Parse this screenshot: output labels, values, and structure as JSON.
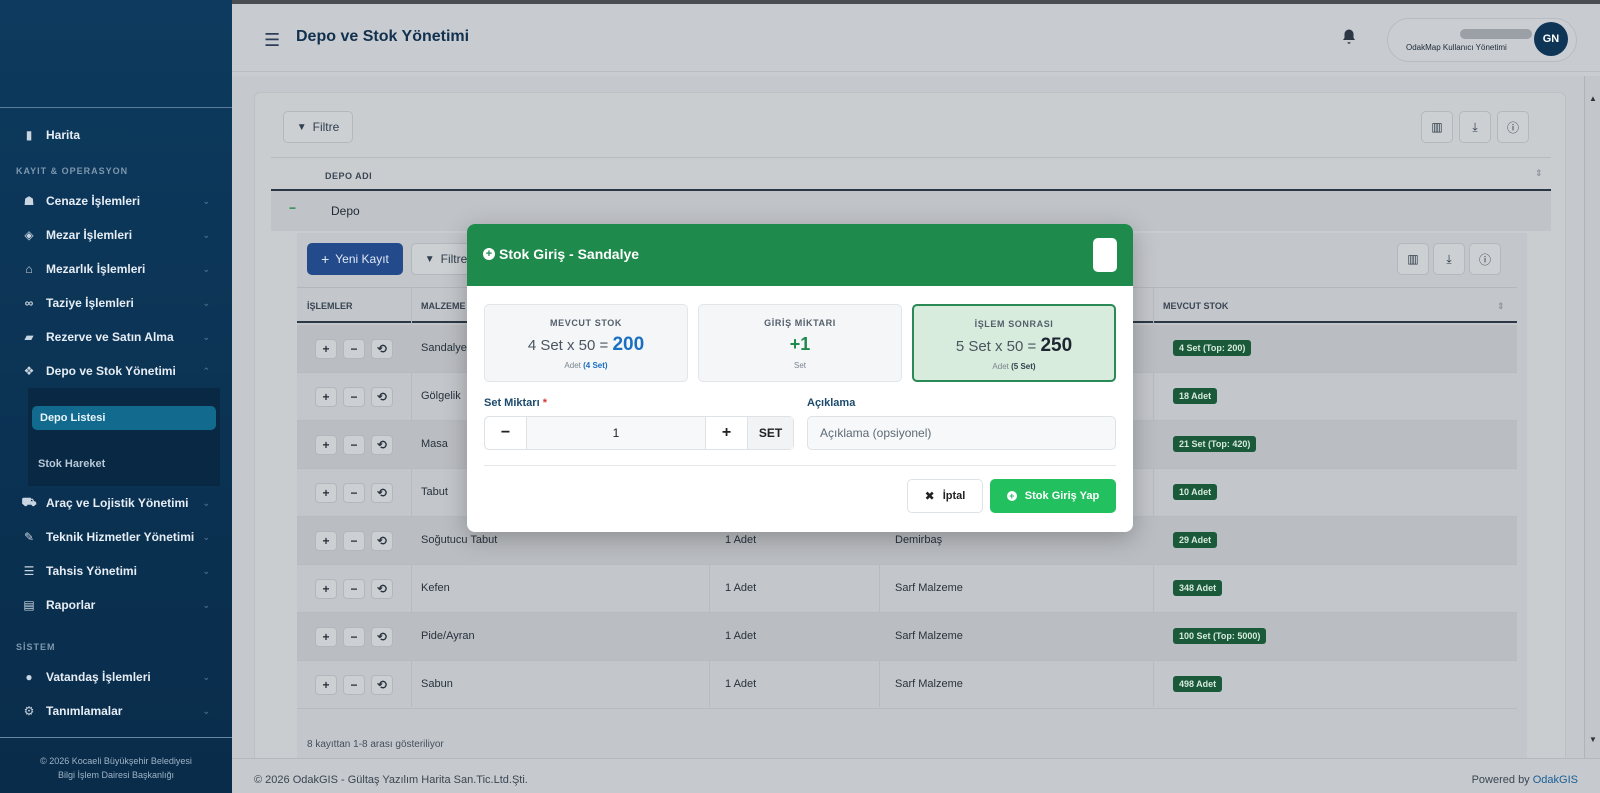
{
  "sidebar": {
    "items_top": [
      {
        "label": "Harita",
        "icon": "map-icon"
      }
    ],
    "section_ops": "KAYIT & OPERASYON",
    "items_ops": [
      {
        "label": "Cenaze İşlemleri",
        "icon": "users-icon"
      },
      {
        "label": "Mezar İşlemleri",
        "icon": "cube-icon"
      },
      {
        "label": "Mezarlık İşlemleri",
        "icon": "building-icon"
      },
      {
        "label": "Taziye İşlemleri",
        "icon": "handshake-icon"
      },
      {
        "label": "Rezerve ve Satın Alma",
        "icon": "bookmark-icon"
      },
      {
        "label": "Depo ve Stok Yönetimi",
        "icon": "boxes-icon"
      }
    ],
    "submenu": [
      "Depo Listesi",
      "Stok Hareket"
    ],
    "items_ops2": [
      {
        "label": "Araç ve Lojistik Yönetimi",
        "icon": "car-icon"
      },
      {
        "label": "Teknik Hizmetler Yönetimi",
        "icon": "wrench-icon"
      },
      {
        "label": "Tahsis Yönetimi",
        "icon": "list-icon"
      },
      {
        "label": "Raporlar",
        "icon": "file-icon"
      }
    ],
    "section_sys": "SİSTEM",
    "items_sys": [
      {
        "label": "Vatandaş İşlemleri",
        "icon": "user-icon"
      },
      {
        "label": "Tanımlamalar",
        "icon": "cogs-icon"
      }
    ],
    "footer_line1": "© 2026 Kocaeli Büyükşehir Belediyesi",
    "footer_line2": "Bilgi İşlem Dairesi Başkanlığı"
  },
  "header": {
    "title": "Depo ve Stok Yönetimi",
    "user_role": "OdakMap Kullanıcı Yönetimi",
    "avatar": "GN"
  },
  "content": {
    "filter_label": "Filtre",
    "outer_col": "DEPO ADI",
    "outer_row": "Depo",
    "new_button": "Yeni Kayıt",
    "inner_filter": "Filtre",
    "columns": [
      "İŞLEMLER",
      "MALZEME",
      "MEVCUT STOK"
    ],
    "rows": [
      {
        "name": "Sandalye",
        "unit": "",
        "type": "",
        "stock": "4 Set (Top: 200)"
      },
      {
        "name": "Gölgelik",
        "unit": "",
        "type": "",
        "stock": "18 Adet"
      },
      {
        "name": "Masa",
        "unit": "",
        "type": "",
        "stock": "21 Set (Top: 420)"
      },
      {
        "name": "Tabut",
        "unit": "",
        "type": "",
        "stock": "10 Adet"
      },
      {
        "name": "Soğutucu Tabut",
        "unit": "1 Adet",
        "type": "Demirbaş",
        "stock": "29 Adet"
      },
      {
        "name": "Kefen",
        "unit": "1 Adet",
        "type": "Sarf Malzeme",
        "stock": "348 Adet"
      },
      {
        "name": "Pide/Ayran",
        "unit": "1 Adet",
        "type": "Sarf Malzeme",
        "stock": "100 Set (Top: 5000)"
      },
      {
        "name": "Sabun",
        "unit": "1 Adet",
        "type": "Sarf Malzeme",
        "stock": "498 Adet"
      }
    ],
    "pager_text": "8 kayıttan 1-8 arası gösteriliyor"
  },
  "footer": {
    "left": "© 2026 OdakGIS - Gültaş Yazılım Harita San.Tic.Ltd.Şti.",
    "right_prefix": "Powered by",
    "right_brand": "OdakGIS"
  },
  "modal": {
    "title": "Stok Giriş - Sandalye",
    "current": {
      "label": "MEVCUT STOK",
      "formula": "4 Set x 50 =",
      "total": "200",
      "unit": "Adet",
      "sets": "(4 Set)"
    },
    "entry": {
      "label": "GİRİŞ MİKTARI",
      "value": "+1",
      "unit": "Set"
    },
    "after": {
      "label": "İŞLEM SONRASI",
      "formula": "5 Set x 50 =",
      "total": "250",
      "unit": "Adet",
      "sets": "(5 Set)"
    },
    "set_label": "Set Miktarı",
    "required_mark": "*",
    "set_value": "1",
    "set_unit": "SET",
    "desc_label": "Açıklama",
    "desc_placeholder": "Açıklama (opsiyonel)",
    "cancel": "İptal",
    "submit": "Stok Giriş Yap"
  },
  "colors": {
    "accent_green": "#1e8a4c",
    "submit_green": "#22c05f",
    "sidebar": "#0d3a5e",
    "highlight_blue": "#1a6fc0"
  }
}
